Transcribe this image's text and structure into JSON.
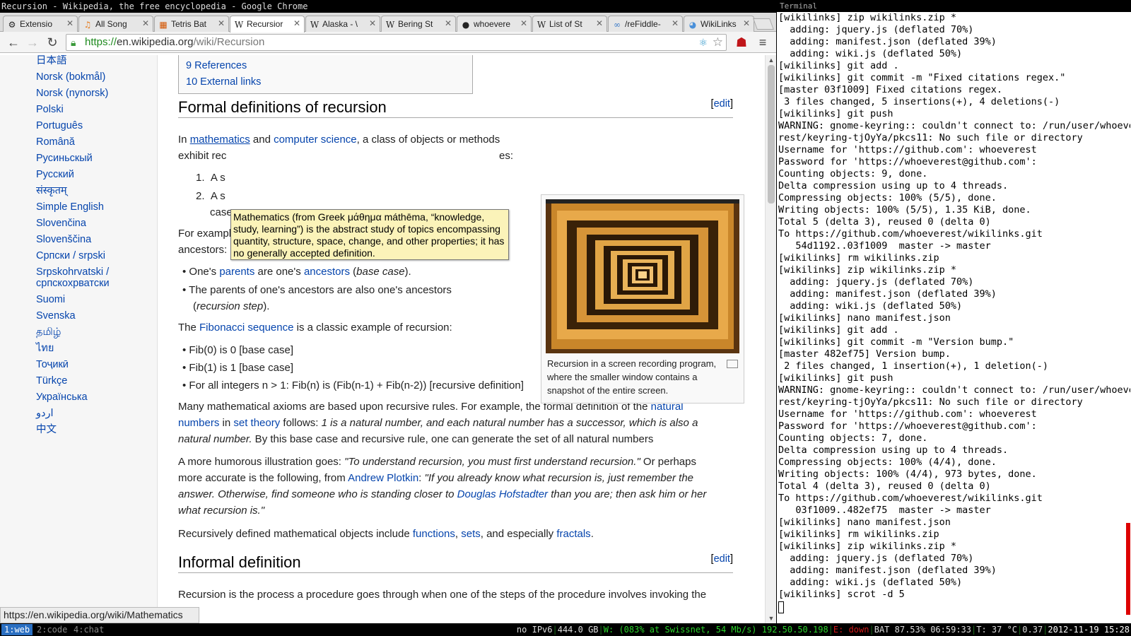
{
  "window_title": "Recursion - Wikipedia, the free encyclopedia - Google Chrome",
  "tabs": [
    {
      "label": "Extensio",
      "icon": "puzzle-icon"
    },
    {
      "label": "All Song",
      "icon": "music-icon"
    },
    {
      "label": "Tetris Bat",
      "icon": "tetris-icon"
    },
    {
      "label": "Recursior",
      "icon": "wikipedia-icon",
      "active": true
    },
    {
      "label": "Alaska - \\",
      "icon": "wikipedia-icon"
    },
    {
      "label": "Bering St",
      "icon": "wikipedia-icon"
    },
    {
      "label": "whoevere",
      "icon": "github-icon"
    },
    {
      "label": "List of St",
      "icon": "wikipedia-icon"
    },
    {
      "label": "/reFiddle-",
      "icon": "fiddle-icon"
    },
    {
      "label": "WikiLinks",
      "icon": "chrome-icon"
    }
  ],
  "url": {
    "scheme": "https://",
    "host": "en.wikipedia.org",
    "path": "/wiki/Recursion"
  },
  "languages": [
    "日本語",
    "Norsk (bokmål)",
    "Norsk (nynorsk)",
    "Polski",
    "Português",
    "Română",
    "Русиньскый",
    "Русский",
    "संस्कृतम्",
    "Simple English",
    "Slovenčina",
    "Slovenščina",
    "Српски / srpski",
    "Srpskohrvatski /",
    "српскохрватски",
    "Suomi",
    "Svenska",
    "தமிழ்",
    "ไทย",
    "Тоҷикӣ",
    "Türkçe",
    "Українська",
    "اردو",
    "中文"
  ],
  "toc": [
    "9 References",
    "10 External links"
  ],
  "section1": {
    "title": "Formal definitions of recursion",
    "edit": "[edit]"
  },
  "section2": {
    "title": "Informal definition",
    "edit": "[edit]"
  },
  "p1": {
    "a": "In ",
    "l1": "mathematics",
    "b": " and ",
    "l2": "computer science",
    "c": ", a class of objects or methods",
    "d": "exhibit rec",
    "e": "es:"
  },
  "ol": {
    "i1_num": "1.",
    "i1": "A s",
    "i2_num": "2.",
    "i2": "A s",
    "i2b": "case."
  },
  "p2": "For example, the following is a recursive definition of a person's ancestors:",
  "ancestors": {
    "a1": "One's ",
    "l1": "parents",
    "a2": " are one's ",
    "l2": "ancestors",
    "a3": " (",
    "a4": "base case",
    "a5": ").",
    "b1": "The parents of one's ancestors are also one's ancestors",
    "b2": "(",
    "b3": "recursion step",
    "b4": ")."
  },
  "p3": {
    "a": "The ",
    "l": "Fibonacci sequence",
    "b": " is a classic example of recursion:"
  },
  "fib": [
    "Fib(0) is 0 [base case]",
    "Fib(1) is 1 [base case]",
    "For all integers n > 1: Fib(n) is (Fib(n-1) + Fib(n-2)) [recursive definition]"
  ],
  "p4": {
    "a": "Many mathematical axioms are based upon recursive rules. For example, the formal definition of the ",
    "l1": "natural",
    "l1b": "numbers",
    "b": " in ",
    "l2": "set theory",
    "c": " follows: ",
    "i1": "1 is a natural number, and each natural number has a successor, which is also a",
    "i2": "natural number.",
    "d": " By this base case and recursive rule, one can generate the set of all natural numbers"
  },
  "p5": {
    "a": "A more humorous illustration goes: ",
    "q1": "\"To understand recursion, you must first understand recursion.\"",
    "b": " Or perhaps",
    "c": "more accurate is the following, from ",
    "l1": "Andrew Plotkin",
    "d": ": ",
    "q2": "\"If you already know what recursion is, just remember the",
    "q3": "answer. Otherwise, find someone who is standing closer to ",
    "l2": "Douglas Hofstadter",
    "q4": " than you are; then ask him or her",
    "q5": "what recursion is.\""
  },
  "p6": {
    "a": "Recursively defined mathematical objects include ",
    "l1": "functions",
    "b": ", ",
    "l2": "sets",
    "c": ", and especially ",
    "l3": "fractals",
    "d": "."
  },
  "p7": "Recursion is the process a procedure goes through when one of the steps of the procedure involves invoking the",
  "thumb_caption": "Recursion in a screen recording program, where the smaller window contains a snapshot of the entire screen.",
  "tooltip": "Mathematics (from Greek μάθημα máthēma, “knowledge, study, learning”) is the abstract study of topics encompassing quantity, structure, space, change, and other properties; it has no generally accepted definition.",
  "status_url": "https://en.wikipedia.org/wiki/Mathematics",
  "terminal_title": "Terminal",
  "terminal_lines": [
    "[wikilinks] zip wikilinks.zip *",
    "  adding: jquery.js (deflated 70%)",
    "  adding: manifest.json (deflated 39%)",
    "  adding: wiki.js (deflated 50%)",
    "[wikilinks] git add .",
    "[wikilinks] git commit -m \"Fixed citations regex.\"",
    "[master 03f1009] Fixed citations regex.",
    " 3 files changed, 5 insertions(+), 4 deletions(-)",
    "[wikilinks] git push",
    "WARNING: gnome-keyring:: couldn't connect to: /run/user/whoeve",
    "rest/keyring-tjOyYa/pkcs11: No such file or directory",
    "Username for 'https://github.com': whoeverest",
    "Password for 'https://whoeverest@github.com':",
    "Counting objects: 9, done.",
    "Delta compression using up to 4 threads.",
    "Compressing objects: 100% (5/5), done.",
    "Writing objects: 100% (5/5), 1.35 KiB, done.",
    "Total 5 (delta 3), reused 0 (delta 0)",
    "To https://github.com/whoeverest/wikilinks.git",
    "   54d1192..03f1009  master -> master",
    "[wikilinks] rm wikilinks.zip",
    "[wikilinks] zip wikilinks.zip *",
    "  adding: jquery.js (deflated 70%)",
    "  adding: manifest.json (deflated 39%)",
    "  adding: wiki.js (deflated 50%)",
    "[wikilinks] nano manifest.json",
    "[wikilinks] git add .",
    "[wikilinks] git commit -m \"Version bump.\"",
    "[master 482ef75] Version bump.",
    " 2 files changed, 1 insertion(+), 1 deletion(-)",
    "[wikilinks] git push",
    "WARNING: gnome-keyring:: couldn't connect to: /run/user/whoeve",
    "rest/keyring-tjOyYa/pkcs11: No such file or directory",
    "Username for 'https://github.com': whoeverest",
    "Password for 'https://whoeverest@github.com':",
    "Counting objects: 7, done.",
    "Delta compression using up to 4 threads.",
    "Compressing objects: 100% (4/4), done.",
    "Writing objects: 100% (4/4), 973 bytes, done.",
    "Total 4 (delta 3), reused 0 (delta 0)",
    "To https://github.com/whoeverest/wikilinks.git",
    "   03f1009..482ef75  master -> master",
    "[wikilinks] nano manifest.json",
    "[wikilinks] rm wikilinks.zip",
    "[wikilinks] zip wikilinks.zip *",
    "  adding: jquery.js (deflated 70%)",
    "  adding: manifest.json (deflated 39%)",
    "  adding: wiki.js (deflated 50%)",
    "[wikilinks] scrot -d 5"
  ],
  "workspaces": [
    "1:web",
    "2:code",
    "4:chat"
  ],
  "statusbar": {
    "ipv6": "no IPv6",
    "disk": "444.0 GB",
    "wifi_label": "W: ",
    "wifi": "(083% at Swissnet, 54 Mb/s) 192.50.50.198",
    "eth": "E: down",
    "bat": "BAT 87.53% 06:59:33",
    "temp": "T: 37 °C",
    "load": "0.37",
    "clock": "2012-11-19 15:28"
  },
  "colors": {
    "link": "#0645ad",
    "accent": "#2a6fc2",
    "ok": "#2bd22b",
    "err": "#d01a1a"
  }
}
